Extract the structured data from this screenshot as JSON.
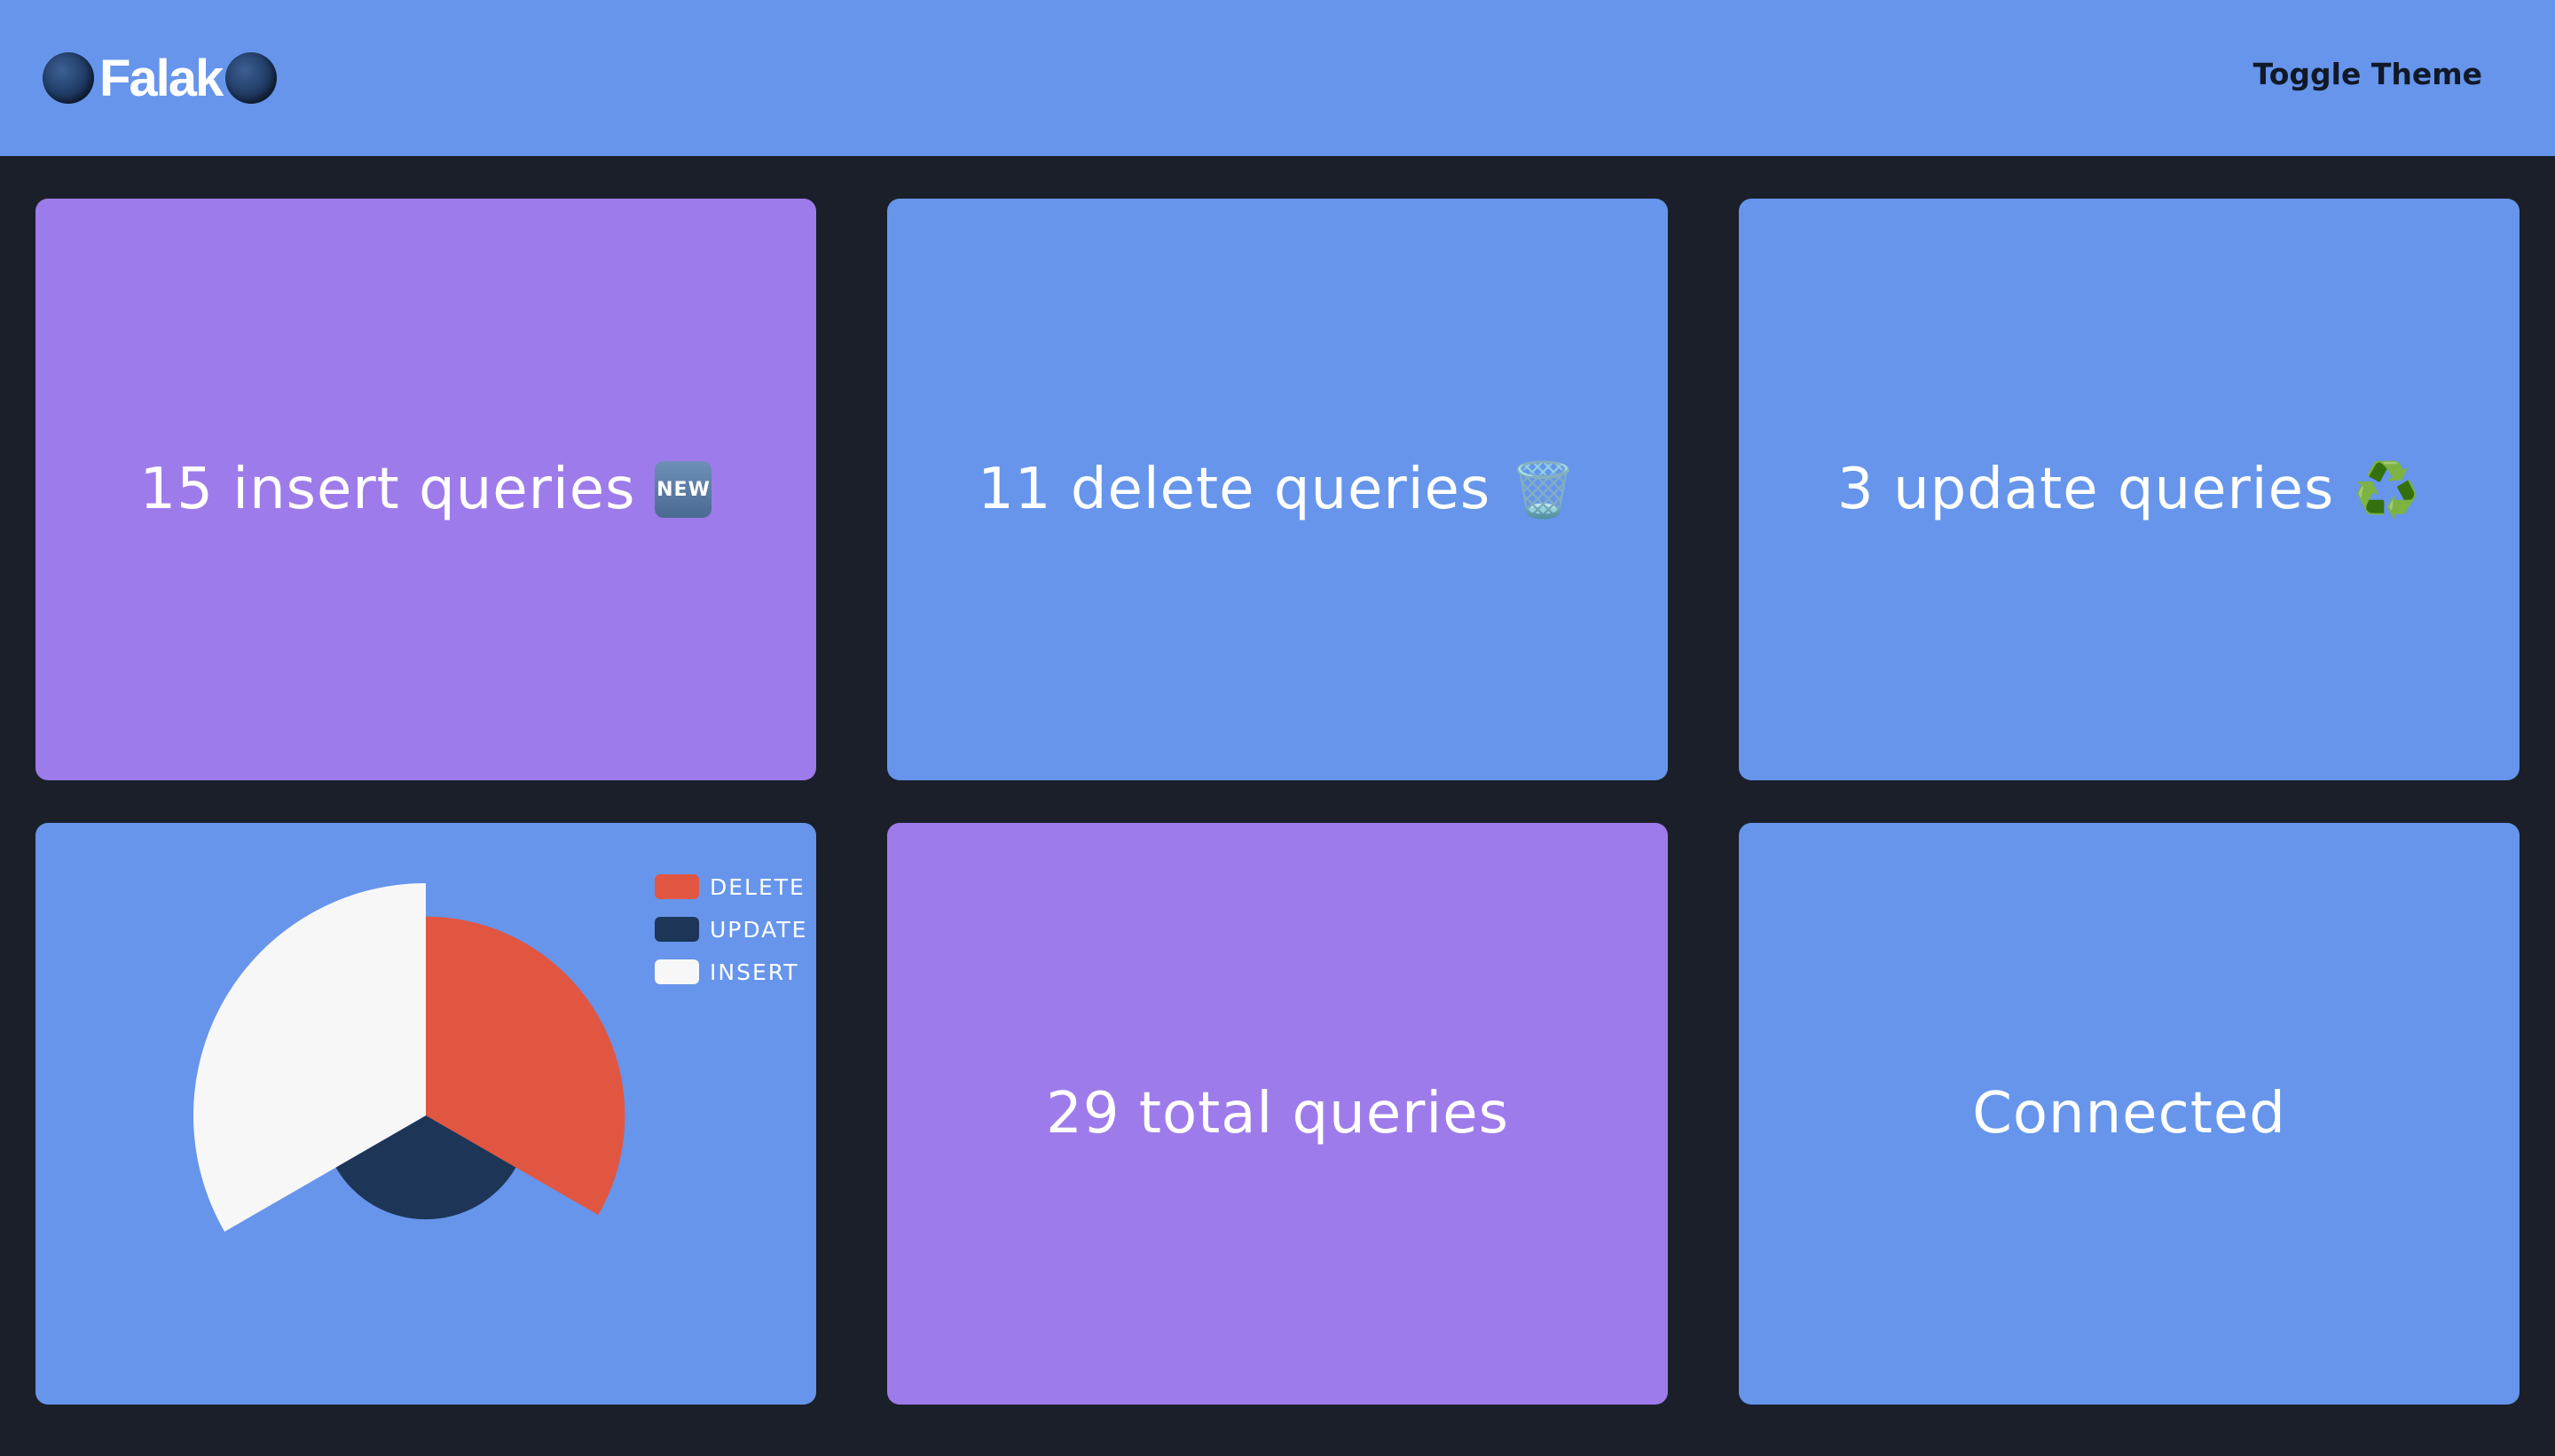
{
  "header": {
    "app_name": "Falak",
    "toggle_label": "Toggle Theme",
    "logo_icon": "globe-icon",
    "background": "#6695eb"
  },
  "cards": {
    "insert": {
      "text": "15 insert queries",
      "icon": "new-badge-icon",
      "badge_text": "NEW"
    },
    "delete": {
      "text": "11 delete queries",
      "icon": "wastebasket-icon",
      "emoji": "🗑️"
    },
    "update": {
      "text": "3 update queries",
      "icon": "recycle-icon",
      "emoji": "♻️"
    },
    "total": {
      "text": "29 total queries"
    },
    "status": {
      "text": "Connected"
    }
  },
  "colors": {
    "purple": "#9e7bea",
    "blue": "#6695eb",
    "page_background": "#1b1f2a",
    "delete": "#e15641",
    "update": "#1d3557",
    "insert": "#f7f7f7"
  },
  "chart_data": {
    "type": "pie",
    "variant": "polar-area",
    "title": "",
    "legend_position": "top-right",
    "categories": [
      "DELETE",
      "UPDATE",
      "INSERT"
    ],
    "values": [
      11,
      3,
      15
    ],
    "series": [
      {
        "name": "DELETE",
        "value": 11,
        "color": "#e15641"
      },
      {
        "name": "UPDATE",
        "value": 3,
        "color": "#1d3557"
      },
      {
        "name": "INSERT",
        "value": 15,
        "color": "#f7f7f7"
      }
    ]
  }
}
